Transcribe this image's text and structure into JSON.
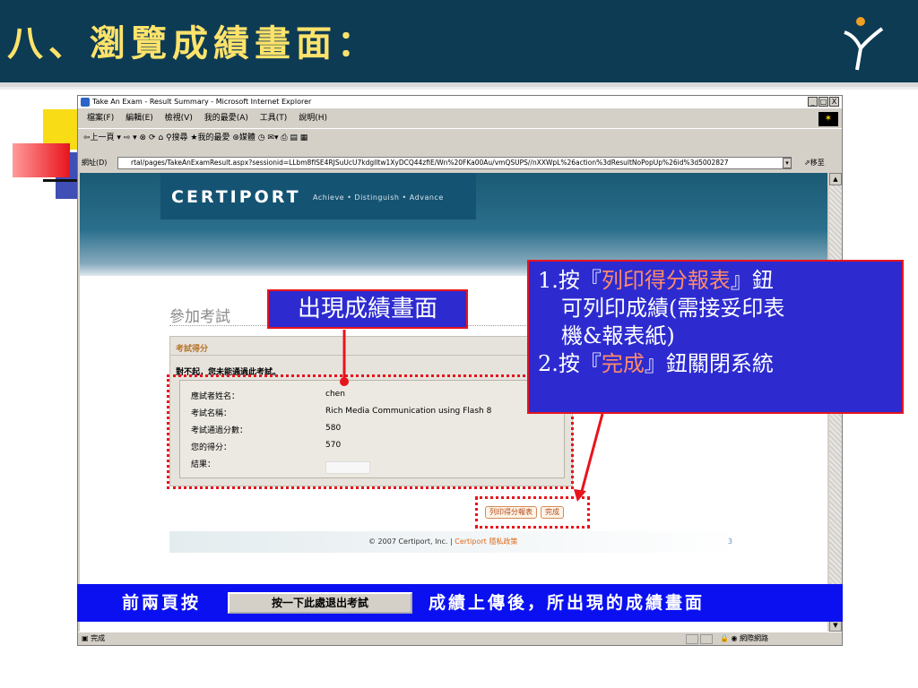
{
  "slide": {
    "title": "八、瀏覽成績畫面："
  },
  "window": {
    "title": "Take An Exam - Result Summary - Microsoft Internet Explorer",
    "controls": [
      "_",
      "□",
      "X"
    ],
    "menu": [
      "檔案(F)",
      "編輯(E)",
      "檢視(V)",
      "我的最愛(A)",
      "工具(T)",
      "說明(H)"
    ],
    "toolbar": "⇦上一頁 ▾ ⇨ ▾ ⊗ ⟳ ⌂  ⚲搜尋  ★我的最愛  ⊛媒體  ◷  ✉▾ ⎙ ▤ ▦",
    "address_label": "網址(D)",
    "address_value": "rtal/pages/TakeAnExamResult.aspx?sessionid=LLbm8fISE4RJSuUcU7kdgIltw1XyDCQ44zfiE/Wn%20FKa00Au/vmQSUPS//nXXWpL%26action%3dResultNoPopUp%26id%3d5002827",
    "address_go": "⇗移至",
    "status_left": "完成",
    "status_zone": "網際網路"
  },
  "certport": {
    "logo": "CERTIPORT",
    "tagline": "Achieve • Distinguish • Advance",
    "heading": "參加考試",
    "panel_title": "考試得分",
    "sorry": "對不起，您未能通過此考試。",
    "rows": [
      {
        "label": "應試者姓名：",
        "value": "chen"
      },
      {
        "label": "考試名稱：",
        "value": "Rich Media Communication using Flash 8"
      },
      {
        "label": "考試通過分數：",
        "value": "580"
      },
      {
        "label": "您的得分：",
        "value": "570"
      },
      {
        "label": "結果：",
        "value": ""
      }
    ],
    "print_button": "列印得分報表",
    "done_button": "完成",
    "footer_copyright": "© 2007 Certiport, Inc.  |  ",
    "footer_link": "Certiport 隱私政策",
    "footer_page": "3"
  },
  "annotations": {
    "callout_red": "出現成績畫面",
    "callout_blue": {
      "line1_pre": "1.按『",
      "line1_hl": "列印得分報表",
      "line1_post": "』鈕",
      "line2": "可列印成績(需接妥印表",
      "line3": "機&報表紙)",
      "line4_pre": "2.按『",
      "line4_hl": "完成",
      "line4_post": "』鈕關閉系統"
    },
    "banner_left": "前兩頁按",
    "banner_button": "按一下此處退出考試",
    "banner_right": "成績上傳後，所出現的成績畫面"
  },
  "colors": {
    "title_bg": "#0d3b54",
    "title_text": "#ffe36b",
    "callout_bg": "#2d2bd0",
    "callout_border": "#e8141c",
    "banner_bg": "#0a10f0"
  },
  "icons": [
    "logo-mark-icon",
    "ie-icon",
    "throbber-icon",
    "page-icon",
    "lock-icon",
    "globe-icon"
  ]
}
